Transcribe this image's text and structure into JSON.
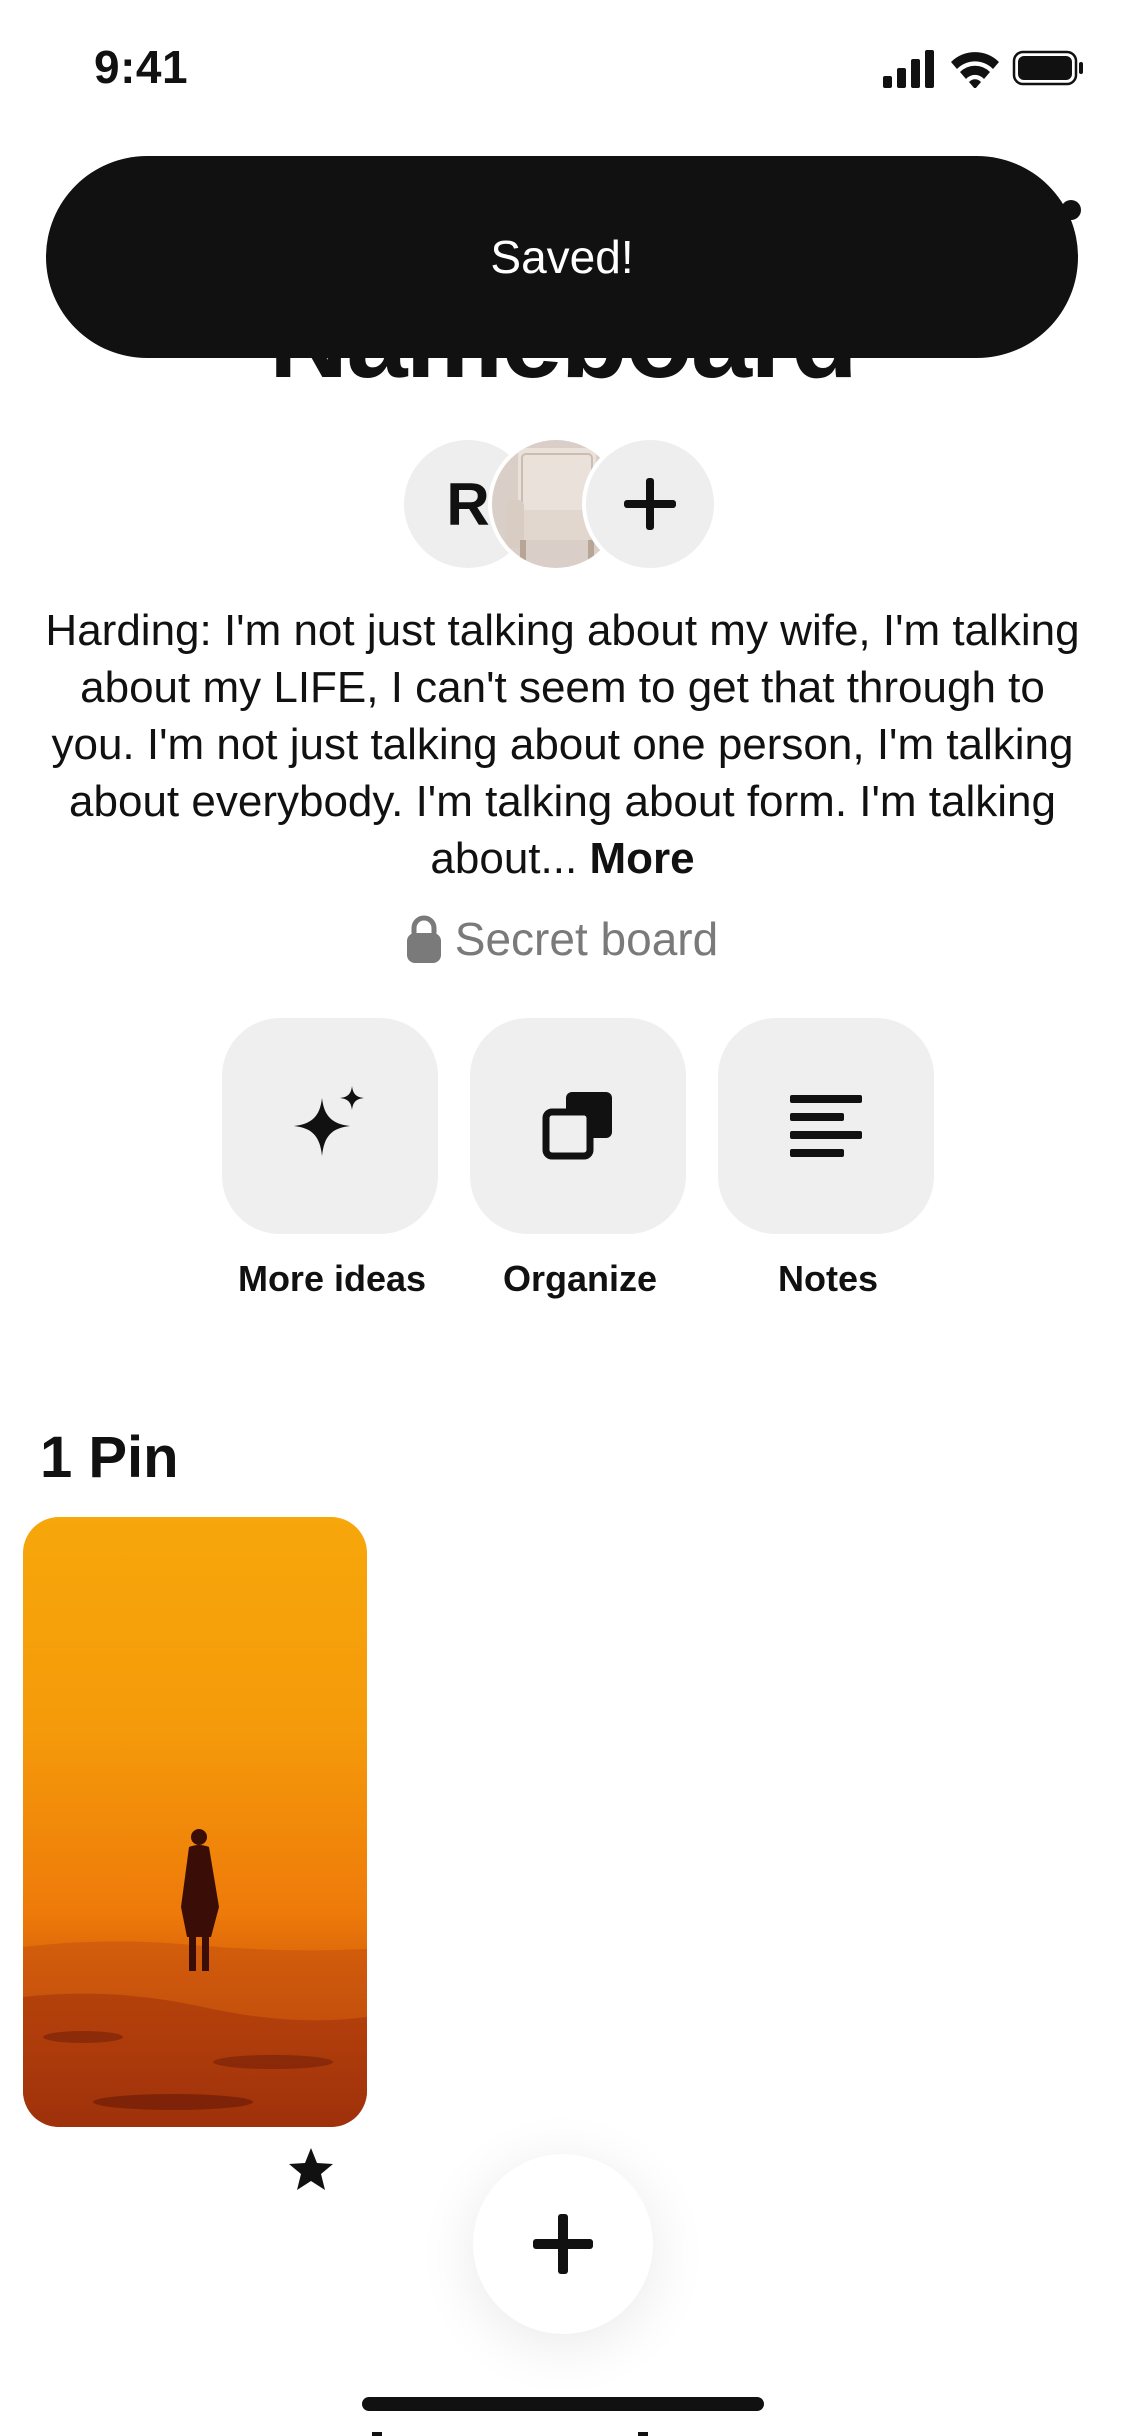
{
  "status_bar": {
    "time": "9:41"
  },
  "toast": {
    "message": "Saved!"
  },
  "board": {
    "title": "Nameboard",
    "collaborator_initial": "R",
    "description": "Harding: I'm not just talking about my wife, I'm talking about my LIFE, I can't seem to get that through to you. I'm not just talking about one person, I'm talking about everybody. I'm talking about form. I'm talking about...",
    "more_label": "More",
    "privacy_label": "Secret board"
  },
  "actions": [
    {
      "label": "More ideas",
      "icon": "sparkle-icon"
    },
    {
      "label": "Organize",
      "icon": "organize-icon"
    },
    {
      "label": "Notes",
      "icon": "notes-icon"
    }
  ],
  "pins": {
    "count_label": "1 Pin"
  },
  "fab": {
    "icon": "plus-icon"
  },
  "colors": {
    "toast_bg": "#111111",
    "tile_bg": "#efefef",
    "secondary_text": "#7a7a7a"
  }
}
